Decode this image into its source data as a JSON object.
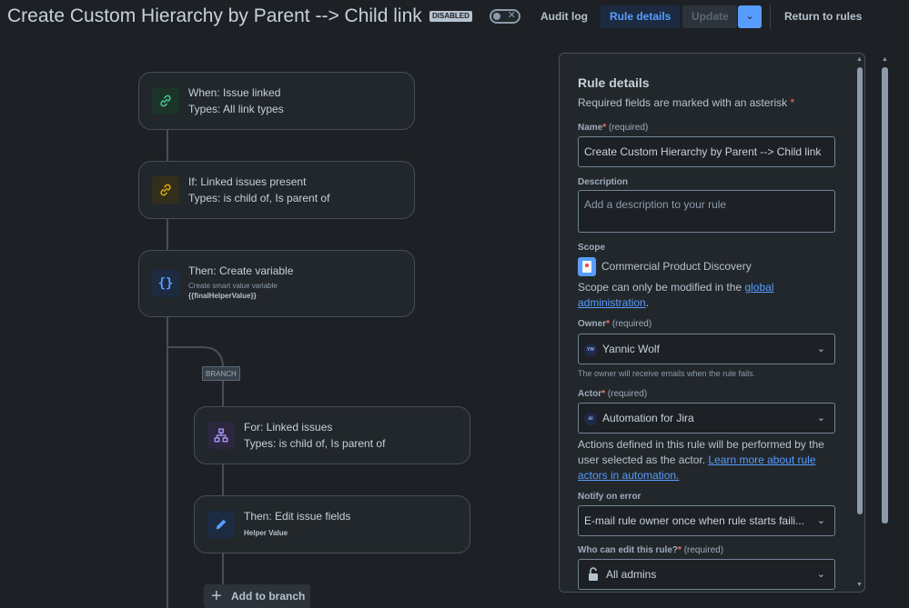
{
  "header": {
    "title": "Create Custom Hierarchy by Parent --> Child link",
    "status_badge": "DISABLED",
    "toggle_icon": "close-icon",
    "audit_log": "Audit log",
    "rule_details": "Rule details",
    "update": "Update",
    "return_to_rules": "Return to rules"
  },
  "flow": {
    "trigger": {
      "title": "When: Issue linked",
      "sub": "Types: All link types",
      "icon": "link-icon",
      "color": "#4bce97"
    },
    "condition": {
      "title": "If: Linked issues present",
      "sub": "Types: is child of, Is parent of",
      "icon": "link-icon",
      "color": "#e2b203"
    },
    "action": {
      "title": "Then: Create variable",
      "small": "Create smart value variable",
      "bold": "{{finalHelperValue}}",
      "icon": "braces-icon",
      "color": "#579dff"
    },
    "branch_label": "BRANCH",
    "branch": {
      "title": "For: Linked issues",
      "sub": "Types: is child of, Is parent of",
      "icon": "hierarchy-icon",
      "color": "#9f8fef"
    },
    "branch_action": {
      "title": "Then: Edit issue fields",
      "bold": "Helper Value",
      "icon": "pencil-icon",
      "color": "#579dff"
    },
    "add_to_branch": "Add to branch"
  },
  "panel": {
    "heading": "Rule details",
    "required_note": "Required fields are marked with an asterisk",
    "name_label": "Name",
    "required": "(required)",
    "name_value": "Create Custom Hierarchy by Parent --> Child link",
    "description_label": "Description",
    "description_placeholder": "Add a description to your rule",
    "scope_label": "Scope",
    "scope_value": "Commercial Product Discovery",
    "scope_note_pre": "Scope can only be modified in the ",
    "scope_note_link1": "global",
    "scope_note_link2": "administration",
    "scope_note_post": ".",
    "owner_label": "Owner",
    "owner_avatar": "YW",
    "owner_value": "Yannic Wolf",
    "owner_note": "The owner will receive emails when the rule fails.",
    "actor_label": "Actor",
    "actor_avatar": "AI",
    "actor_value": "Automation for Jira",
    "actor_note_1": "Actions defined in this rule will be performed by the",
    "actor_note_2_pre": "user selected as the actor. ",
    "actor_note_2_link": "Learn more about rule",
    "actor_note_3_link": "actors in automation.",
    "notify_label": "Notify on error",
    "notify_value": "E-mail rule owner once when rule starts faili...",
    "who_edit_label": "Who can edit this rule?",
    "who_edit_value": "All admins"
  }
}
